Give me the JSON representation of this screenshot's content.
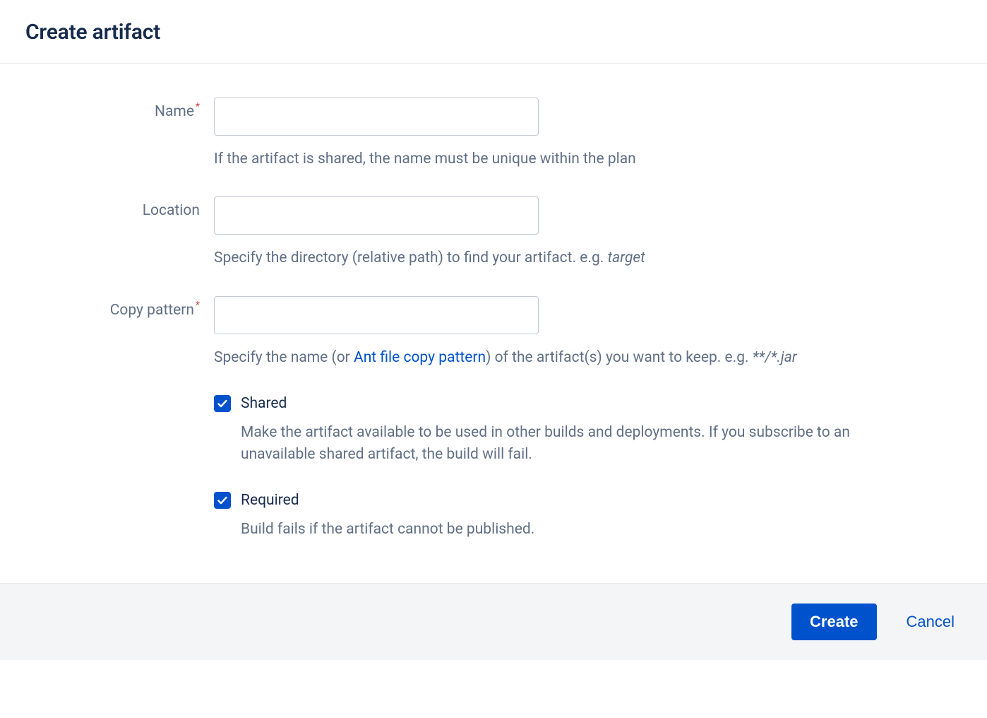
{
  "header": {
    "title": "Create artifact"
  },
  "fields": {
    "name": {
      "label": "Name",
      "value": "",
      "help": "If the artifact is shared, the name must be unique within the plan"
    },
    "location": {
      "label": "Location",
      "value": "",
      "help_pre": "Specify the directory (relative path) to find your artifact. e.g. ",
      "help_example": "target"
    },
    "copy_pattern": {
      "label": "Copy pattern",
      "value": "",
      "help_pre": "Specify the name (or ",
      "help_link": "Ant file copy pattern",
      "help_post": ") of the artifact(s) you want to keep. e.g. ",
      "help_example": "**/*.jar"
    },
    "shared": {
      "label": "Shared",
      "checked": true,
      "help": "Make the artifact available to be used in other builds and deployments. If you subscribe to an unavailable shared artifact, the build will fail."
    },
    "required": {
      "label": "Required",
      "checked": true,
      "help": "Build fails if the artifact cannot be published."
    }
  },
  "footer": {
    "create": "Create",
    "cancel": "Cancel"
  }
}
